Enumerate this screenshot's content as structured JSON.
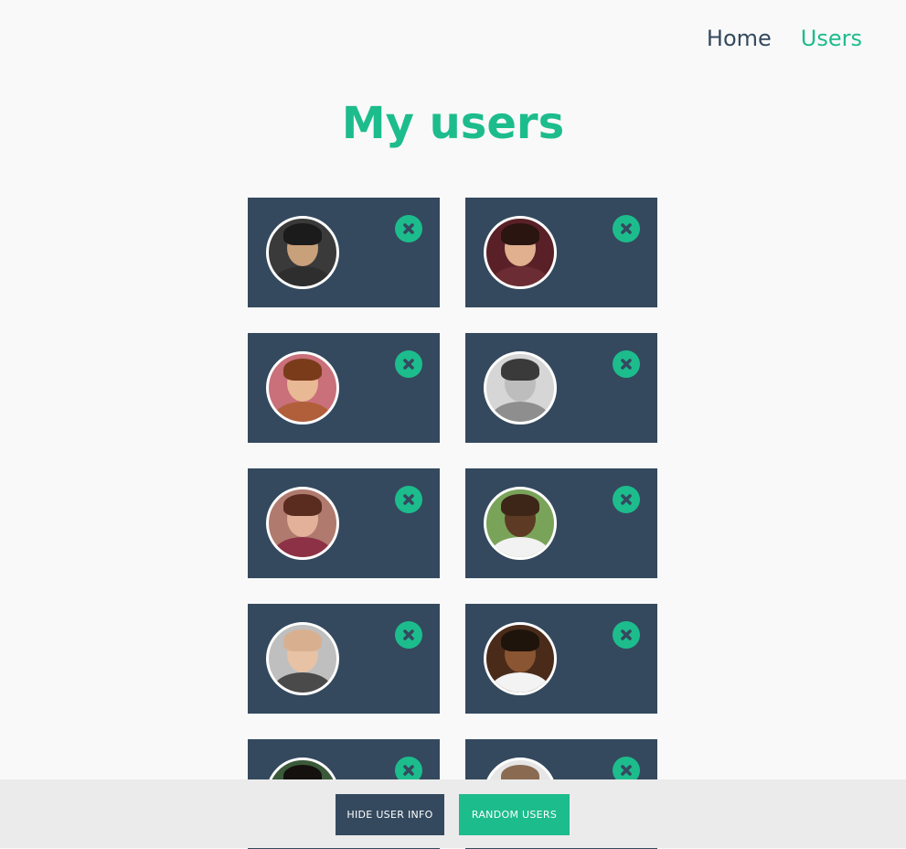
{
  "nav": {
    "items": [
      {
        "label": "Home",
        "active": false
      },
      {
        "label": "Users",
        "active": true
      }
    ]
  },
  "page": {
    "title": "My users"
  },
  "users": [
    {
      "avatar": "man-glasses",
      "skin": "#c8a07a",
      "hair": "#1b1b1b",
      "shirt": "#2e2e2e",
      "bg": "#3a3a3a"
    },
    {
      "avatar": "woman-dark-hair",
      "skin": "#e0b08f",
      "hair": "#2a1510",
      "shirt": "#6b2d33",
      "bg": "#5a2027"
    },
    {
      "avatar": "woman-smiling",
      "skin": "#e9b894",
      "hair": "#7a3b1b",
      "shirt": "#b15f3a",
      "bg": "#c9707a"
    },
    {
      "avatar": "man-black-white",
      "skin": "#bdbdbd",
      "hair": "#3a3a3a",
      "shirt": "#8e8e8e",
      "bg": "#d6d6d6"
    },
    {
      "avatar": "woman-brown-hair",
      "skin": "#e3b199",
      "hair": "#5a2c1f",
      "shirt": "#8d3147",
      "bg": "#b07a6e"
    },
    {
      "avatar": "man-bald-glasses",
      "skin": "#5d3a24",
      "hair": "#3d2618",
      "shirt": "#f2f2f2",
      "bg": "#7aa35a"
    },
    {
      "avatar": "man-bald-scarf",
      "skin": "#e8c2a5",
      "hair": "#d9b08f",
      "shirt": "#4a4a4a",
      "bg": "#bfbfbf"
    },
    {
      "avatar": "man-white-shirt",
      "skin": "#8a5532",
      "hair": "#1f140c",
      "shirt": "#f3f3f3",
      "bg": "#4a2b1a"
    },
    {
      "avatar": "woman-partial",
      "skin": "#e2b89a",
      "hair": "#15110e",
      "shirt": "#2b2b2b",
      "bg": "#3a5a3a"
    },
    {
      "avatar": "man-partial",
      "skin": "#c99a78",
      "hair": "#8a6b52",
      "shirt": "#e8e8e8",
      "bg": "#e6e6e6"
    }
  ],
  "footer": {
    "hide_label": "Hide user info",
    "random_label": "Random users"
  },
  "colors": {
    "accent": "#1dbc8c",
    "dark": "#34495e",
    "background": "#f9f9f9",
    "footer_bg": "#ebebeb"
  }
}
